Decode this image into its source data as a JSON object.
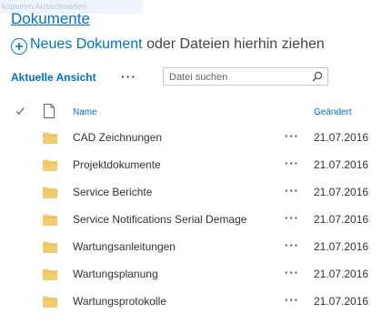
{
  "top_faint": "kopieren Ausschneiden",
  "title": "Dokumente",
  "new_document": {
    "link_label": "Neues Dokument",
    "drop_text": " oder Dateien hierhin ziehen"
  },
  "view": {
    "label": "Aktuelle Ansicht",
    "more_label": "···"
  },
  "search": {
    "placeholder": "Datei suchen",
    "value": ""
  },
  "columns": {
    "name": "Name",
    "modified": "Geändert"
  },
  "colors": {
    "accent": "#0072c6",
    "folder": "#f2cc6e"
  },
  "rows": [
    {
      "name": "CAD Zeichnungen",
      "date": "21.07.2016",
      "more": "···"
    },
    {
      "name": "Projektdokumente",
      "date": "21.07.2016",
      "more": "···"
    },
    {
      "name": "Service Berichte",
      "date": "21.07.2016",
      "more": "···"
    },
    {
      "name": "Service Notifications Serial Demage",
      "date": "21.07.2016",
      "more": "···"
    },
    {
      "name": "Wartungsanleitungen",
      "date": "21.07.2016",
      "more": "···"
    },
    {
      "name": "Wartungsplanung",
      "date": "21.07.2016",
      "more": "···"
    },
    {
      "name": "Wartungsprotokolle",
      "date": "21.07.2016",
      "more": "···"
    }
  ]
}
